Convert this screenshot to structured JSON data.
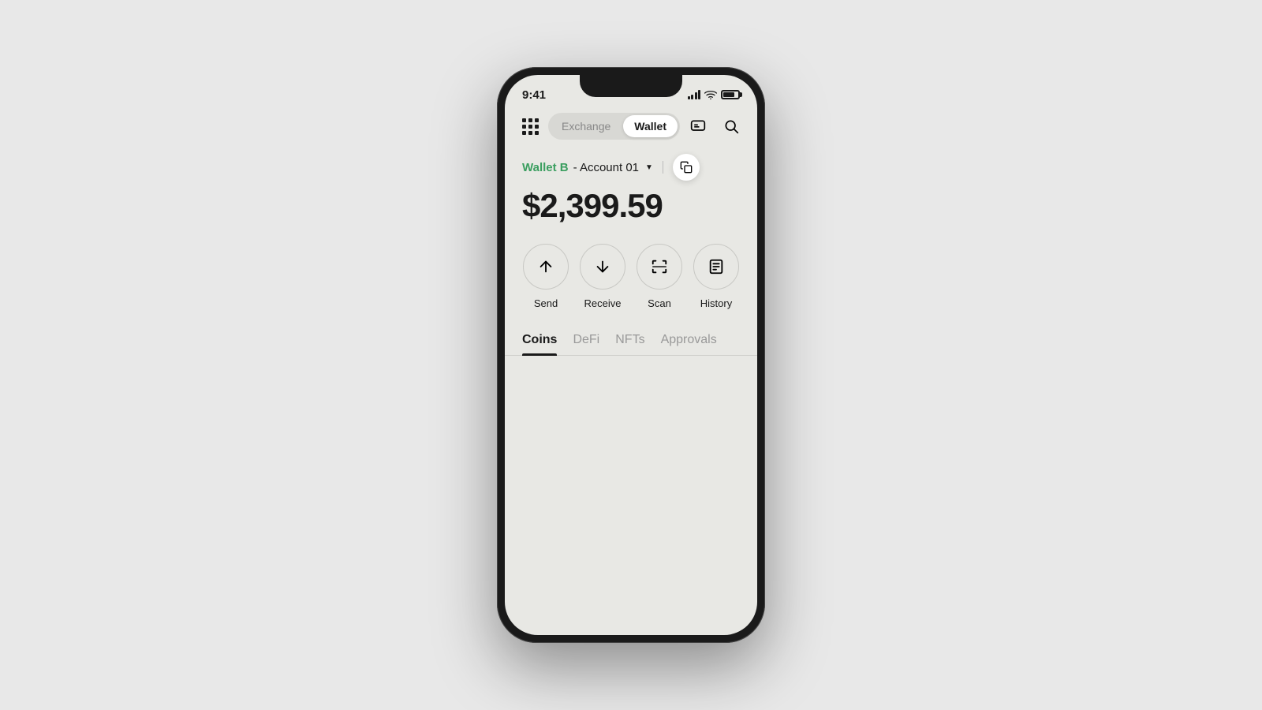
{
  "phone": {
    "status_bar": {
      "time": "9:41",
      "signal_label": "signal",
      "wifi_label": "wifi",
      "battery_label": "battery"
    },
    "header": {
      "grid_icon_label": "apps",
      "tabs": [
        {
          "id": "exchange",
          "label": "Exchange",
          "active": false
        },
        {
          "id": "wallet",
          "label": "Wallet",
          "active": true
        }
      ],
      "chat_icon_label": "messages",
      "search_icon_label": "search"
    },
    "account": {
      "wallet_name": "Wallet B",
      "account_label": "- Account 01",
      "copy_icon_label": "copy-address"
    },
    "balance": {
      "amount": "$2,399.59"
    },
    "actions": [
      {
        "id": "send",
        "label": "Send",
        "icon": "arrow-up"
      },
      {
        "id": "receive",
        "label": "Receive",
        "icon": "arrow-down"
      },
      {
        "id": "scan",
        "label": "Scan",
        "icon": "scan"
      },
      {
        "id": "history",
        "label": "History",
        "icon": "history"
      }
    ],
    "content_tabs": [
      {
        "id": "coins",
        "label": "Coins",
        "active": true
      },
      {
        "id": "defi",
        "label": "DeFi",
        "active": false
      },
      {
        "id": "nfts",
        "label": "NFTs",
        "active": false
      },
      {
        "id": "approvals",
        "label": "Approvals",
        "active": false
      }
    ]
  }
}
